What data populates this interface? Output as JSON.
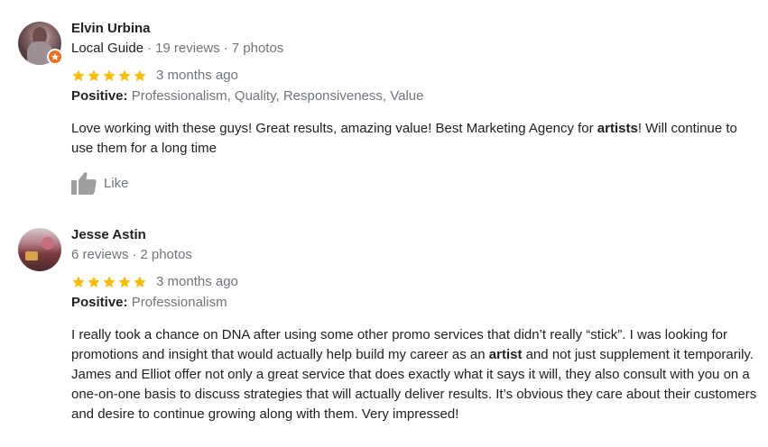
{
  "colors": {
    "star": "#fbbc04",
    "guide_badge": "#ee6d1e",
    "muted_text": "#70757a",
    "primary_text": "#202124",
    "like_icon": "#9e9e9e"
  },
  "reviews": [
    {
      "name": "Elvin Urbina",
      "meta_guide": "Local Guide",
      "meta_reviews": "19 reviews",
      "meta_photos": "7 photos",
      "meta_sep": "·",
      "rating": 5,
      "time": "3 months ago",
      "positive_label": "Positive:",
      "positive_values": "Professionalism, Quality, Responsiveness, Value",
      "text_a": "Love working with these guys! Great results, amazing value! Best Marketing Agency for ",
      "text_bold": "artists",
      "text_b": "! Will continue to use them for a long time",
      "like_label": "Like"
    },
    {
      "name": "Jesse Astin",
      "meta_reviews": "6 reviews",
      "meta_photos": "2 photos",
      "meta_sep": "·",
      "rating": 5,
      "time": "3 months ago",
      "positive_label": "Positive:",
      "positive_values": "Professionalism",
      "text_a": "I really took a chance on DNA after using some other promo services that didn’t really “stick”. I was looking for promotions and insight that would actually help build my career as an ",
      "text_bold": "artist",
      "text_b": " and not just supplement it temporarily. James and Elliot offer not only a great service that does exactly what it says it will, they also consult with you on a one-on-one basis to discuss strategies that will actually deliver results. It’s obvious they care about their customers and desire to continue growing along with them. Very impressed!"
    }
  ]
}
